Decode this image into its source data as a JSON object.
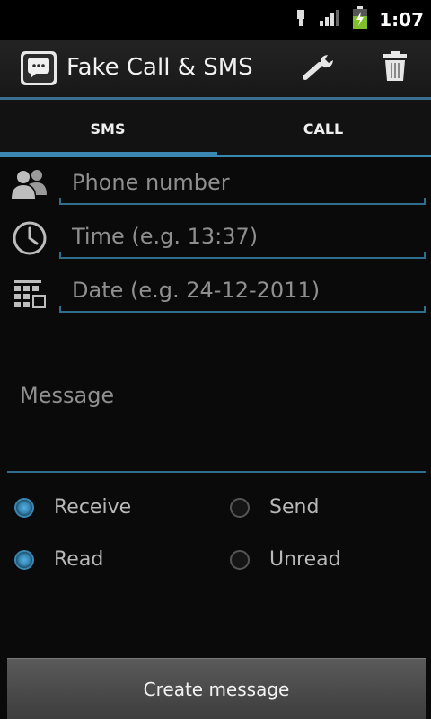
{
  "status_bar": {
    "time": "1:07"
  },
  "action_bar": {
    "title": "Fake Call & SMS",
    "icons": [
      "app-icon",
      "wrench-icon",
      "trash-icon"
    ]
  },
  "tabs": [
    {
      "label": "SMS",
      "selected": true
    },
    {
      "label": "CALL",
      "selected": false
    }
  ],
  "form": {
    "phone": {
      "placeholder": "Phone number",
      "value": ""
    },
    "time": {
      "placeholder": "Time (e.g. 13:37)",
      "value": ""
    },
    "date": {
      "placeholder": "Date (e.g. 24-12-2011)",
      "value": ""
    },
    "message": {
      "placeholder": "Message",
      "value": ""
    }
  },
  "direction": {
    "options": [
      {
        "label": "Receive",
        "checked": true
      },
      {
        "label": "Send",
        "checked": false
      }
    ]
  },
  "read_state": {
    "options": [
      {
        "label": "Read",
        "checked": true
      },
      {
        "label": "Unread",
        "checked": false
      }
    ]
  },
  "create_button": {
    "label": "Create message"
  },
  "colors": {
    "accent": "#3a87b3",
    "background": "#0a0a0a",
    "action_bar": "#1e1e1e"
  }
}
